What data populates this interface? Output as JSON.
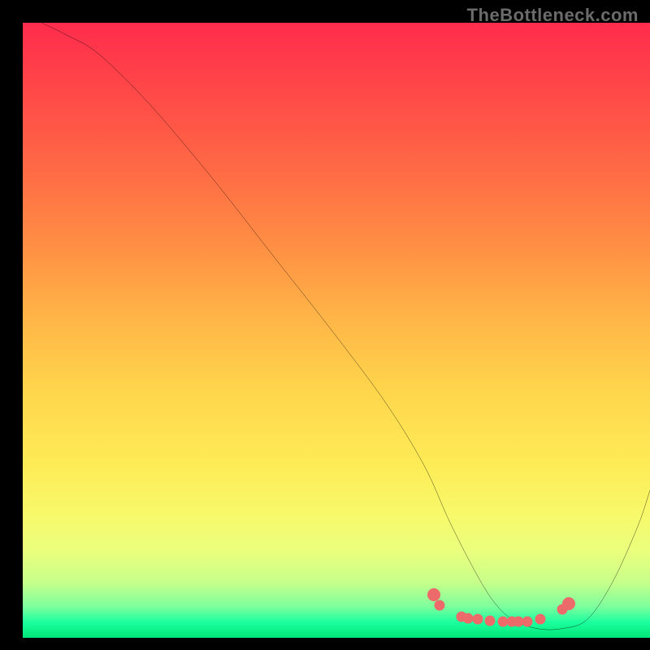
{
  "watermark": "TheBottleneck.com",
  "chart_data": {
    "type": "line",
    "title": "",
    "xlabel": "",
    "ylabel": "",
    "xlim": [
      0,
      100
    ],
    "ylim": [
      0,
      100
    ],
    "grid": false,
    "legend": false,
    "series": [
      {
        "name": "bottleneck-curve",
        "x": [
          3,
          7,
          12,
          20,
          30,
          40,
          50,
          58,
          64,
          68,
          72,
          75,
          78,
          82,
          86,
          90,
          94,
          98,
          100
        ],
        "y": [
          100,
          98,
          95,
          87,
          75,
          62,
          49,
          38,
          28,
          19,
          11,
          6,
          3,
          1.5,
          1.5,
          3,
          9,
          18,
          24
        ]
      }
    ],
    "markers": {
      "name": "highlight-dots",
      "color": "#ed6a6a",
      "points": [
        {
          "x": 65.5,
          "y": 7.0,
          "big": true
        },
        {
          "x": 66.5,
          "y": 5.3
        },
        {
          "x": 70.0,
          "y": 3.4
        },
        {
          "x": 71.0,
          "y": 3.2
        },
        {
          "x": 72.5,
          "y": 3.0
        },
        {
          "x": 74.5,
          "y": 2.8
        },
        {
          "x": 76.5,
          "y": 2.7
        },
        {
          "x": 78.0,
          "y": 2.7
        },
        {
          "x": 79.0,
          "y": 2.7
        },
        {
          "x": 80.5,
          "y": 2.7
        },
        {
          "x": 82.5,
          "y": 3.0
        },
        {
          "x": 86.0,
          "y": 4.6
        },
        {
          "x": 87.0,
          "y": 5.5,
          "big": true
        }
      ]
    },
    "background_gradient": {
      "top": "#ff2c4d",
      "mid": "#ffd64c",
      "bottom": "#00e676"
    }
  }
}
